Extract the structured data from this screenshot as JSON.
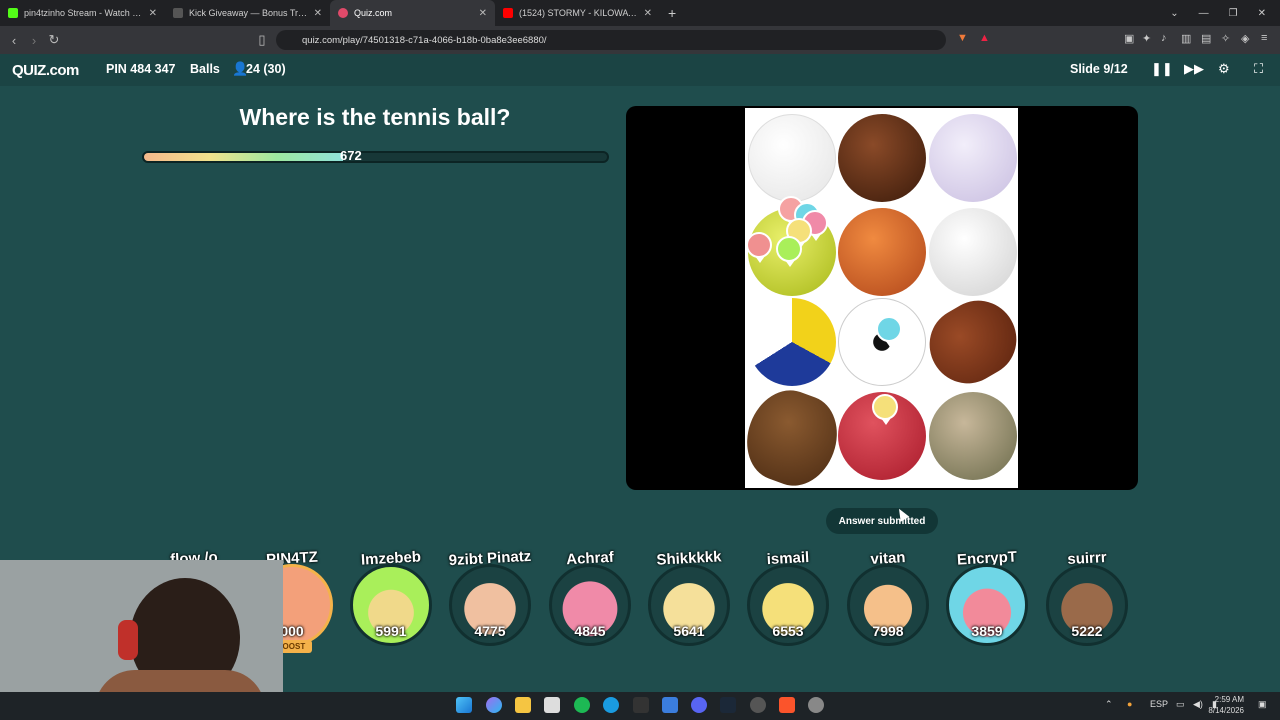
{
  "browser": {
    "tabs": [
      {
        "label": "pin4tzinho Stream - Watch Live on K",
        "color": "#53fc18"
      },
      {
        "label": "Kick Giveaway — Bonus Tracker | Bo",
        "color": "#ffffff"
      },
      {
        "label": "Quiz.com",
        "color": "#e04a6a"
      },
      {
        "label": "(1524) STORMY - KILOWAT (VISUALI",
        "color": "#ff0000"
      }
    ],
    "url": "quiz.com/play/74501318-c71a-4066-b18b-0ba8e3ee6880/"
  },
  "header": {
    "logo_text": "QUIZ.com",
    "pin": "PIN 484 347",
    "topic": "Balls",
    "players": "24 (30)",
    "slide": "Slide 9/12"
  },
  "question": {
    "text": "Where is the tennis ball?",
    "timer_value": "672",
    "timer_fraction": 0.43
  },
  "status": {
    "submitted": "Answer submitted"
  },
  "players": [
    {
      "name": "flow /o",
      "score": "",
      "color": "#f09090"
    },
    {
      "name": "PIN4TZ",
      "score": "000",
      "color": "#f3a07a"
    },
    {
      "name": "Imzebeb",
      "score": "5991",
      "color": "#a9ef5a"
    },
    {
      "name": "9zibt Pinatz",
      "score": "4775",
      "color": "#f0c0a0"
    },
    {
      "name": "Achraf",
      "score": "4845",
      "color": "#f08aa8"
    },
    {
      "name": "Shikkkkk",
      "score": "5641",
      "color": "#f5e09a"
    },
    {
      "name": "ismail",
      "score": "6553",
      "color": "#f5e07a"
    },
    {
      "name": "vitan",
      "score": "7998",
      "color": "#f5c08a"
    },
    {
      "name": "EncrypT",
      "score": "3859",
      "color": "#6fd6e6"
    },
    {
      "name": "suirrr",
      "score": "5222",
      "color": "#9a6a4a"
    }
  ],
  "boost_label": "BOOST",
  "taskbar": {
    "lang": "ESP",
    "time": "2:59 AM",
    "date": "8/14/2026"
  }
}
